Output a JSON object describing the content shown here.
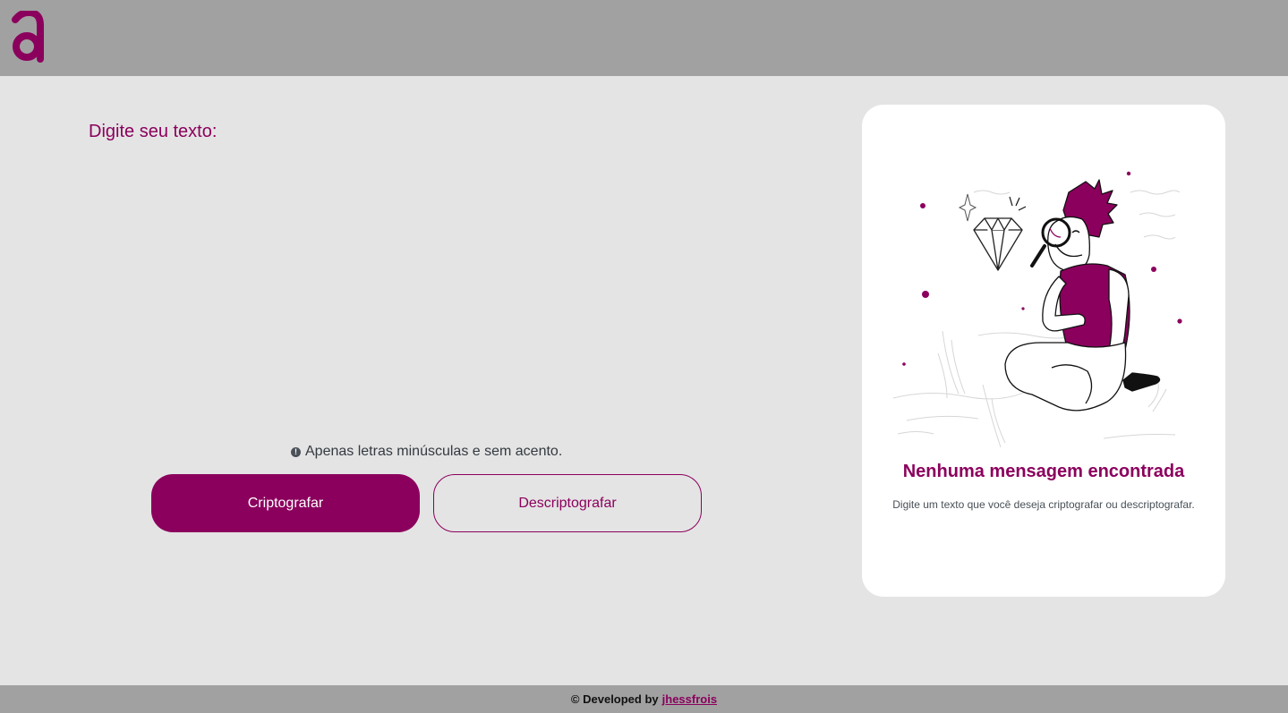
{
  "colors": {
    "accent": "#8b005d",
    "header_bg": "#a1a1a1",
    "page_bg": "#e4e4e4",
    "card_bg": "#ffffff"
  },
  "header": {
    "logo_icon": "letter-a-logo"
  },
  "form": {
    "label": "Digite seu texto:",
    "textarea_value": "",
    "hint_icon": "exclamation-circle-icon",
    "hint_text": "Apenas letras minúsculas e sem acento.",
    "encrypt_label": "Criptografar",
    "decrypt_label": "Descriptografar"
  },
  "output": {
    "illustration": "person-with-magnifying-glass-inspecting-diamond",
    "title": "Nenhuma mensagem encontrada",
    "subtitle": "Digite um texto que você deseja criptografar ou descriptografar."
  },
  "footer": {
    "prefix": "© Developed by",
    "author": "jhessfrois"
  }
}
